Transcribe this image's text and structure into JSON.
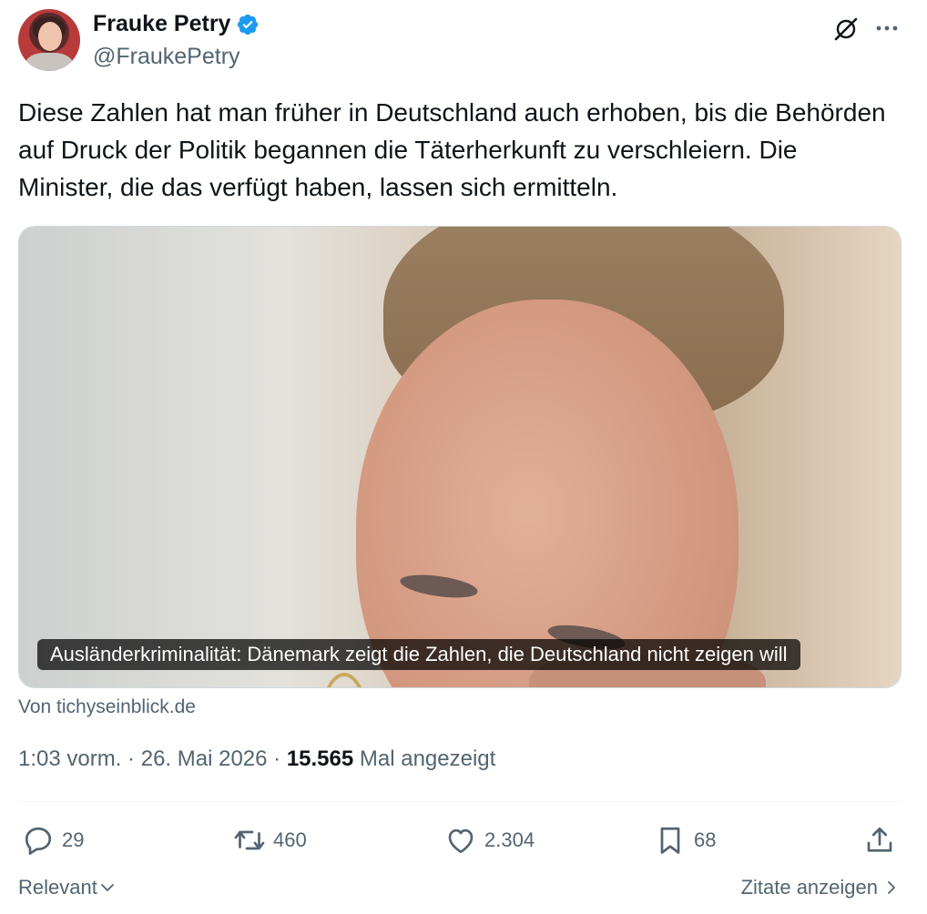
{
  "author": {
    "display_name": "Frauke Petry",
    "handle": "@FraukePetry",
    "verified": true,
    "verified_color": "#1d9bf0"
  },
  "tweet": {
    "text": "Diese Zahlen hat man früher in Deutschland auch erhoben, bis die Behörden auf Druck der Politik begannen die Täterherkunft zu verschleiern. Die Minister, die das verfügt haben, lassen sich ermitteln."
  },
  "media": {
    "caption": "Ausländerkriminalität: Dänemark zeigt die Zahlen, die Deutschland nicht zeigen will",
    "source": "Von tichyseinblick.de"
  },
  "meta": {
    "time": "1:03 vorm.",
    "separator": " · ",
    "date": "26. Mai 2026",
    "views": "15.565",
    "views_label": " Mal angezeigt"
  },
  "actions": {
    "replies": "29",
    "reposts": "460",
    "likes": "2.304",
    "bookmarks": "68"
  },
  "footer": {
    "sort_label": "Relevant",
    "quotes_label": "Zitate anzeigen"
  },
  "icons": {
    "grok": "grok-icon",
    "more": "more-icon",
    "reply": "reply-icon",
    "repost": "repost-icon",
    "like": "heart-icon",
    "bookmark": "bookmark-icon",
    "share": "share-icon"
  },
  "colors": {
    "text_primary": "#0f1419",
    "text_secondary": "#536471",
    "divider": "#eff3f4"
  }
}
